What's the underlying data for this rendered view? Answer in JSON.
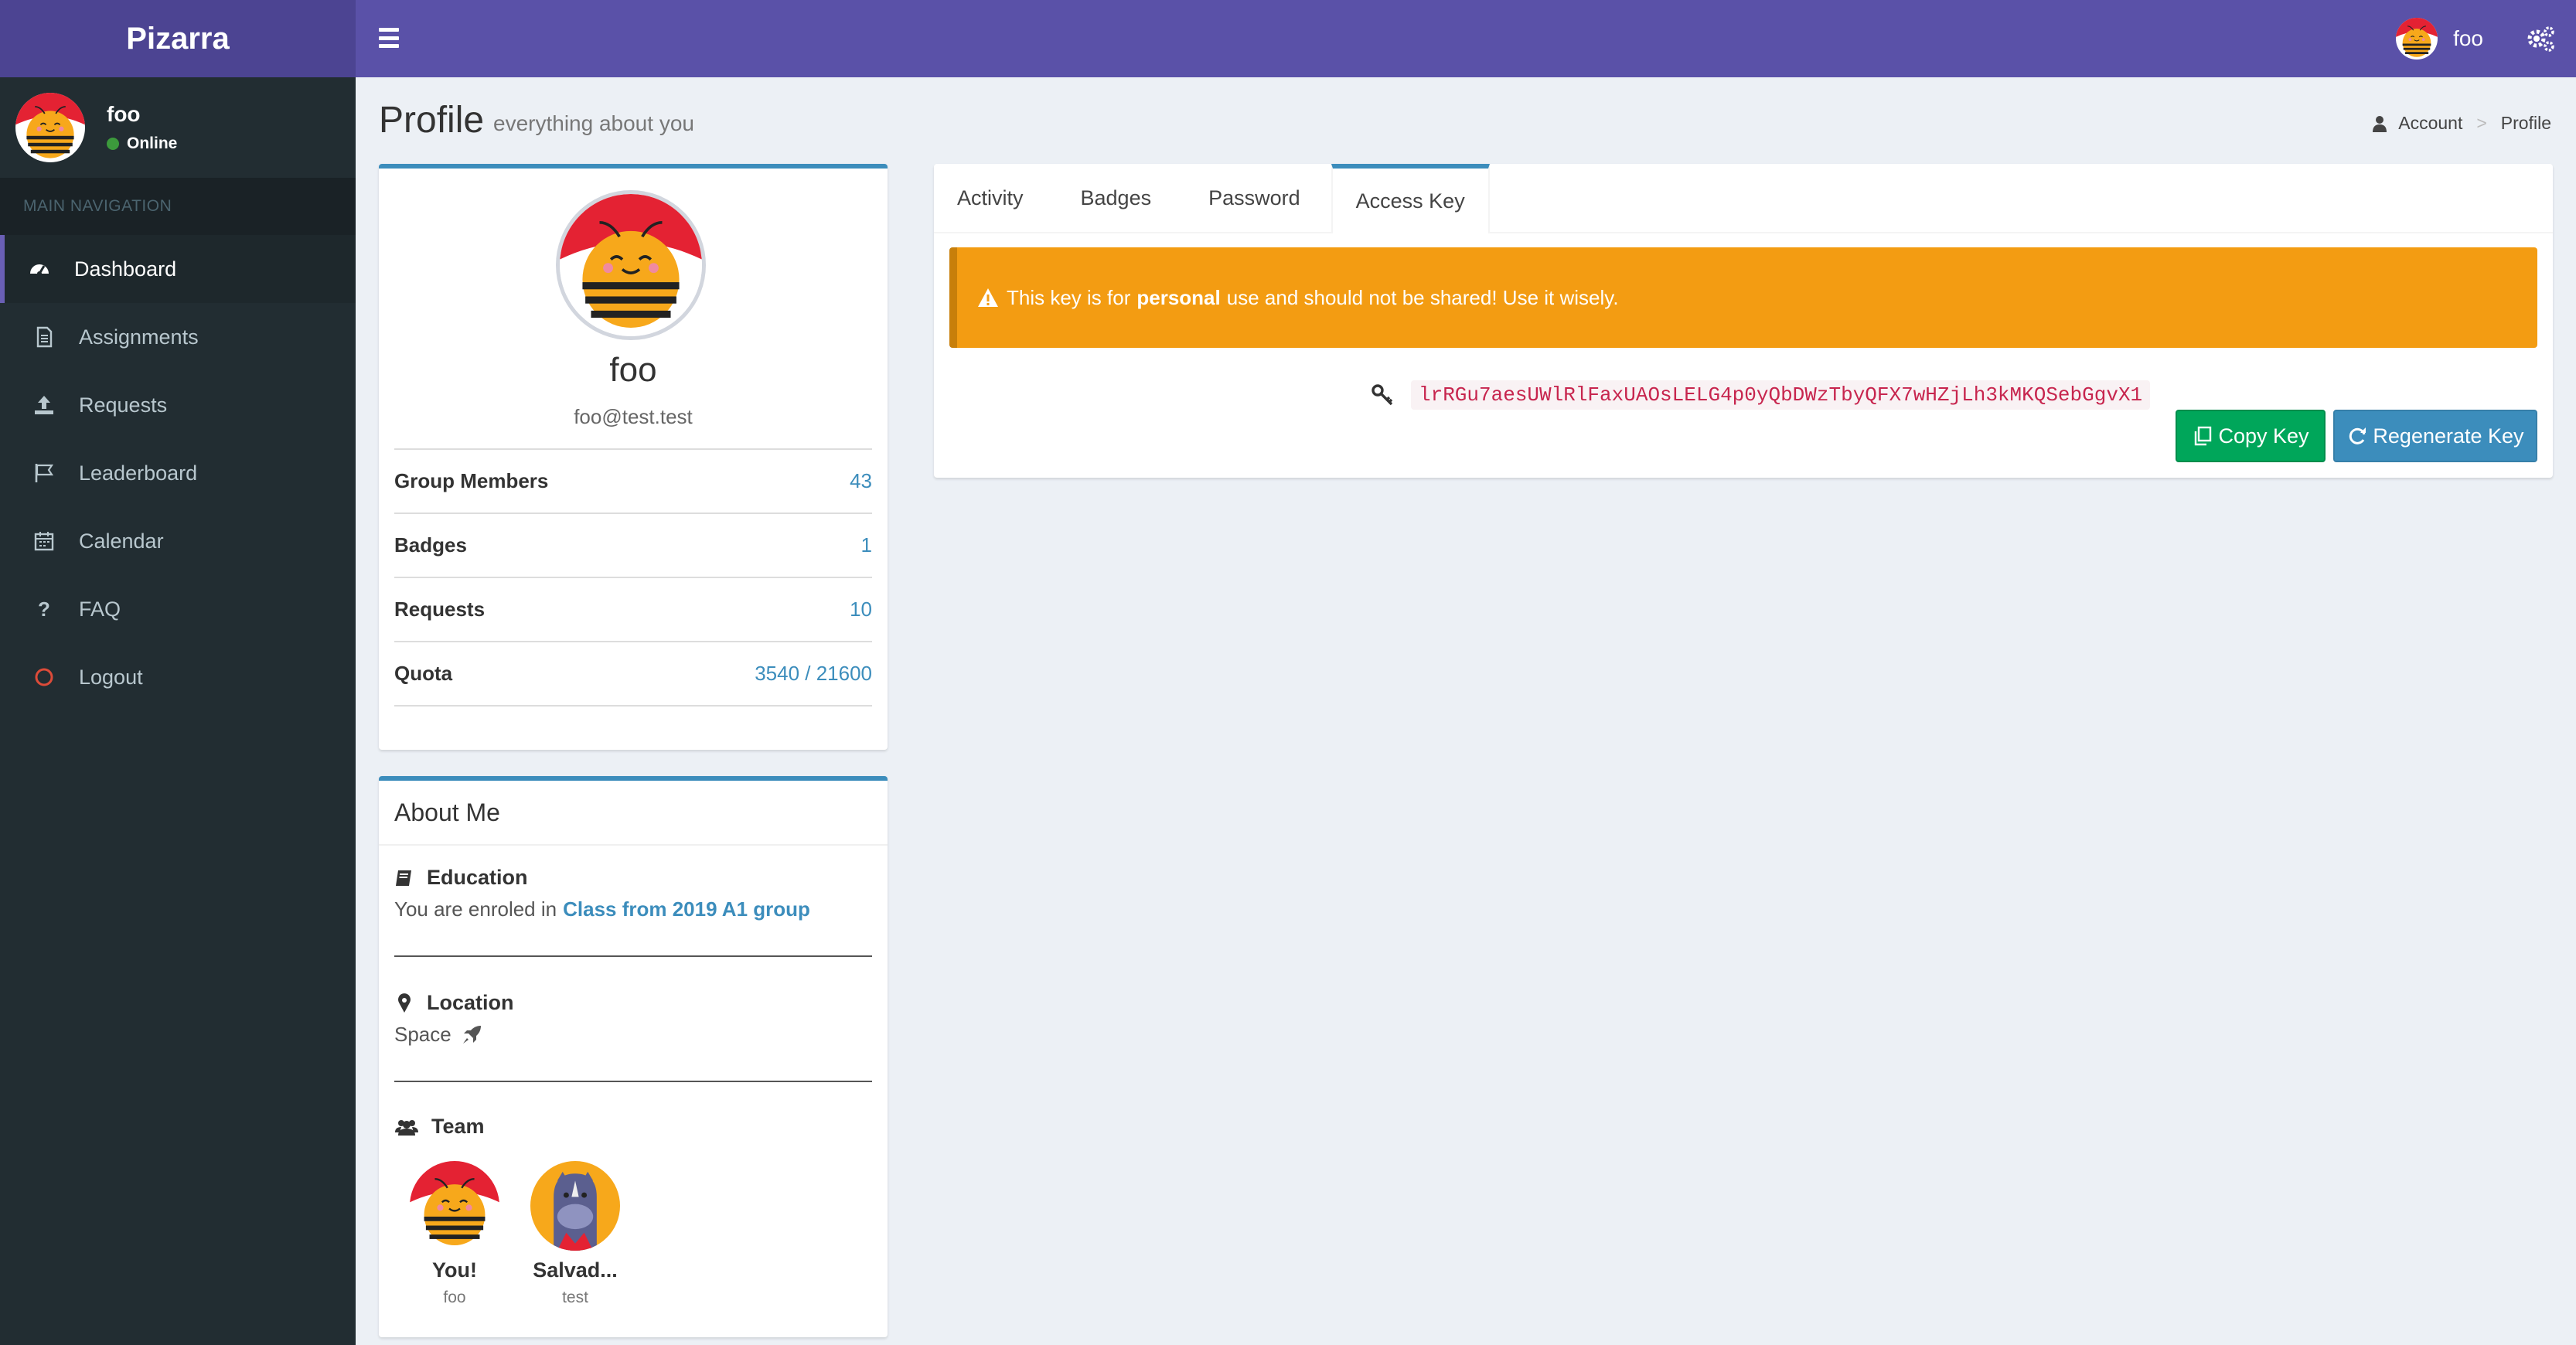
{
  "app": {
    "name": "Pizarra"
  },
  "user": {
    "name": "foo",
    "status": "Online",
    "email": "foo@test.test"
  },
  "sidebar": {
    "header": "MAIN NAVIGATION",
    "items": [
      {
        "label": "Dashboard",
        "icon": "dashboard-icon",
        "active": true
      },
      {
        "label": "Assignments",
        "icon": "file-icon"
      },
      {
        "label": "Requests",
        "icon": "upload-icon"
      },
      {
        "label": "Leaderboard",
        "icon": "flag-icon"
      },
      {
        "label": "Calendar",
        "icon": "calendar-icon"
      },
      {
        "label": "FAQ",
        "icon": "question-icon"
      },
      {
        "label": "Logout",
        "icon": "power-icon"
      }
    ]
  },
  "header": {
    "username": "foo"
  },
  "page": {
    "title": "Profile",
    "subtitle": "everything about you"
  },
  "breadcrumb": {
    "items": [
      "Account",
      "Profile"
    ]
  },
  "profile": {
    "stats": [
      {
        "label": "Group Members",
        "value": "43"
      },
      {
        "label": "Badges",
        "value": "1"
      },
      {
        "label": "Requests",
        "value": "10"
      },
      {
        "label": "Quota",
        "value": "3540 / 21600"
      }
    ]
  },
  "about": {
    "title": "About Me",
    "education": {
      "label": "Education",
      "text": "You are enroled in",
      "link": "Class from 2019 A1 group"
    },
    "location": {
      "label": "Location",
      "text": "Space"
    },
    "team": {
      "label": "Team",
      "members": [
        {
          "name": "You!",
          "group": "foo"
        },
        {
          "name": "Salvad...",
          "group": "test"
        }
      ]
    }
  },
  "tabs": [
    {
      "label": "Activity"
    },
    {
      "label": "Badges"
    },
    {
      "label": "Password"
    },
    {
      "label": "Access Key",
      "active": true
    }
  ],
  "access_key": {
    "alert_pre": "This key is for",
    "alert_bold": "personal",
    "alert_post": "use and should not be shared! Use it wisely.",
    "key": "lrRGu7aesUWlRlFaxUAOsLELG4p0yQbDWzTbyQFX7wHZjLh3kMKQSebGgvX1",
    "copy_label": "Copy Key",
    "regenerate_label": "Regenerate Key"
  },
  "colors": {
    "brand": "#5a51a8",
    "sidebar": "#222d32",
    "accent": "#3c8dbc",
    "warning": "#f39c12",
    "success": "#00a65a"
  }
}
